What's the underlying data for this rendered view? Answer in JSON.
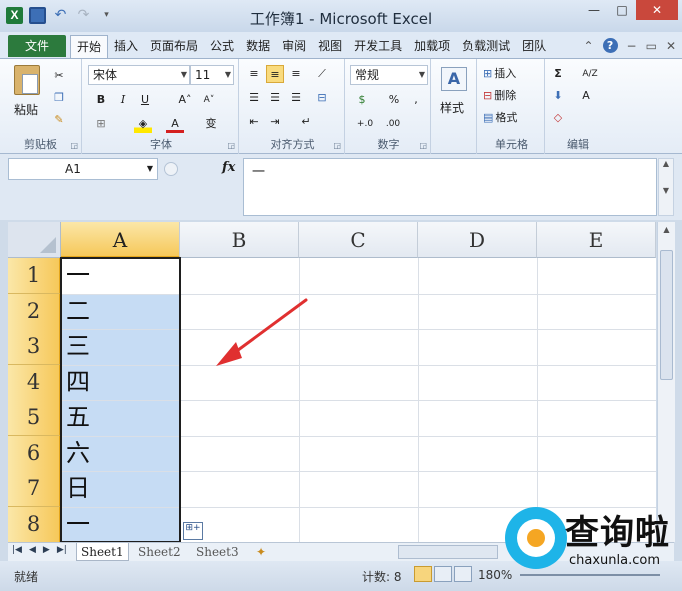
{
  "window": {
    "title": "工作簿1 - Microsoft Excel",
    "controls": [
      "—",
      "□",
      "✕"
    ]
  },
  "qat": {
    "logo": "X",
    "undo": "↶",
    "redo": "↷"
  },
  "ribbon_tabs": {
    "file": "文件",
    "items": [
      "开始",
      "插入",
      "页面布局",
      "公式",
      "数据",
      "审阅",
      "视图",
      "开发工具",
      "加载项",
      "负载测试",
      "团队"
    ],
    "active_index": 0
  },
  "ribbon": {
    "clipboard": {
      "label": "剪贴板",
      "paste": "粘贴"
    },
    "font": {
      "label": "字体",
      "font_name": "宋体",
      "font_size": "11",
      "bold": "B",
      "italic": "I",
      "underline": "U",
      "grow": "A˄",
      "shrink": "A˅",
      "phonetic": "变"
    },
    "alignment": {
      "label": "对齐方式"
    },
    "number": {
      "label": "数字",
      "format": "常规",
      "percent": "%",
      "comma": ",",
      "inc": "+.0",
      "dec": ".00"
    },
    "styles": {
      "label": "样式",
      "styles_btn": "样式"
    },
    "cells": {
      "label": "单元格",
      "insert": "插入",
      "delete": "删除",
      "format": "格式"
    },
    "editing": {
      "label": "编辑",
      "sum": "Σ",
      "sort": "A/Z",
      "find": "A"
    }
  },
  "formula_bar": {
    "name_box": "A1",
    "fx": "fx",
    "content": "一"
  },
  "grid": {
    "columns": [
      "A",
      "B",
      "C",
      "D",
      "E"
    ],
    "selected_column": "A",
    "rows": [
      "1",
      "2",
      "3",
      "4",
      "5",
      "6",
      "7",
      "8"
    ],
    "column_a_values": [
      "一",
      "二",
      "三",
      "四",
      "五",
      "六",
      "日",
      "一"
    ]
  },
  "sheets": {
    "tabs": [
      "Sheet1",
      "Sheet2",
      "Sheet3"
    ],
    "active": "Sheet1"
  },
  "status": {
    "ready": "就绪",
    "count": "计数: 8",
    "zoom": "180%"
  },
  "watermark": {
    "brand": "查询啦",
    "url": "chaxunla.com"
  },
  "colors": {
    "file_tab": "#2c7a3d",
    "selection_fill": "#c6dcf4",
    "header_highlight": "#f6c85a",
    "arrow": "#e03030"
  }
}
